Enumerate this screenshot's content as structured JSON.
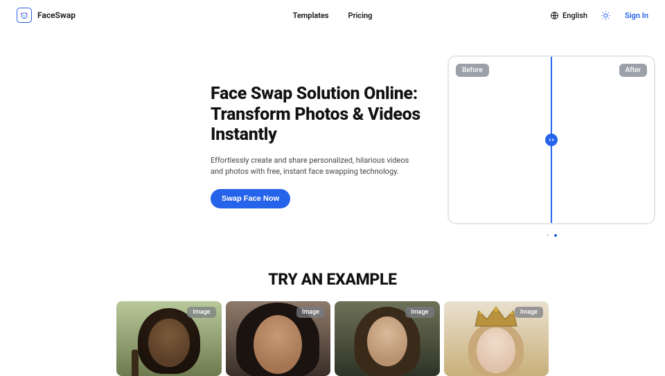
{
  "header": {
    "brand": "FaceSwap",
    "nav": {
      "templates": "Templates",
      "pricing": "Pricing"
    },
    "language": "English",
    "signin": "Sign In"
  },
  "hero": {
    "title": "Face Swap Solution Online: Transform Photos & Videos Instantly",
    "subtitle": "Effortlessly create and share personalized, hilarious videos and photos with free, instant face swapping technology.",
    "cta": "Swap Face Now",
    "before_label": "Before",
    "after_label": "After"
  },
  "carousel": {
    "active_index": 1,
    "count": 2
  },
  "examples": {
    "title": "TRY AN EXAMPLE",
    "cards": [
      {
        "type_label": "Image"
      },
      {
        "type_label": "Image"
      },
      {
        "type_label": "Image"
      },
      {
        "type_label": "Image"
      }
    ]
  },
  "icons": {
    "logo": "cat-face-icon",
    "globe": "globe-icon",
    "theme": "sun-icon",
    "slider_handle": "horizontal-resize-icon",
    "crown": "crown-icon"
  }
}
